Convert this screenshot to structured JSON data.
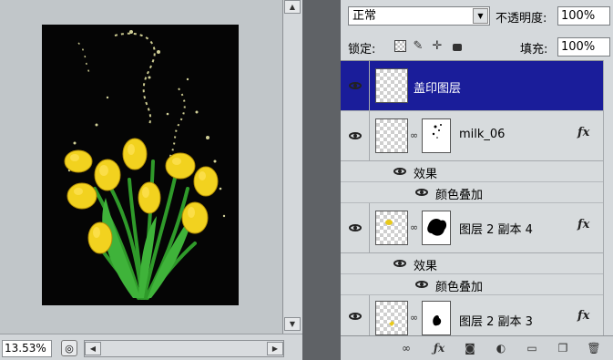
{
  "document": {
    "zoom": "13.53%"
  },
  "layers_panel": {
    "blend_mode": "正常",
    "opacity_label": "不透明度:",
    "opacity_value": "100%",
    "lock_label": "锁定:",
    "fill_label": "填充:",
    "fill_value": "100%",
    "layers": [
      {
        "name": "盖印图层",
        "selected": true
      },
      {
        "name": "milk_06",
        "has_mask": true,
        "has_fx": true,
        "effects_label": "效果",
        "effects": [
          "颜色叠加"
        ]
      },
      {
        "name": "图层 2 副本 4",
        "has_mask": true,
        "has_fx": true,
        "effects_label": "效果",
        "effects": [
          "颜色叠加"
        ]
      },
      {
        "name": "图层 2 副本 3",
        "has_mask": true,
        "has_fx": true
      }
    ],
    "fx_glyph": "fx"
  },
  "colors": {
    "selected_row": "#1a1d9a",
    "panel_bg": "#d5d9dc",
    "canvas_bg": "#c1c6c9"
  },
  "icons": [
    "eye-icon",
    "chain-link-icon",
    "fx-icon",
    "lock-transparency-icon",
    "lock-brush-icon",
    "lock-move-icon",
    "lock-all-icon",
    "hand-cursor-icon",
    "navigator-icon",
    "link-layers-icon",
    "add-style-icon",
    "add-mask-icon",
    "adjustment-layer-icon",
    "new-group-icon",
    "new-layer-icon",
    "trash-icon"
  ]
}
